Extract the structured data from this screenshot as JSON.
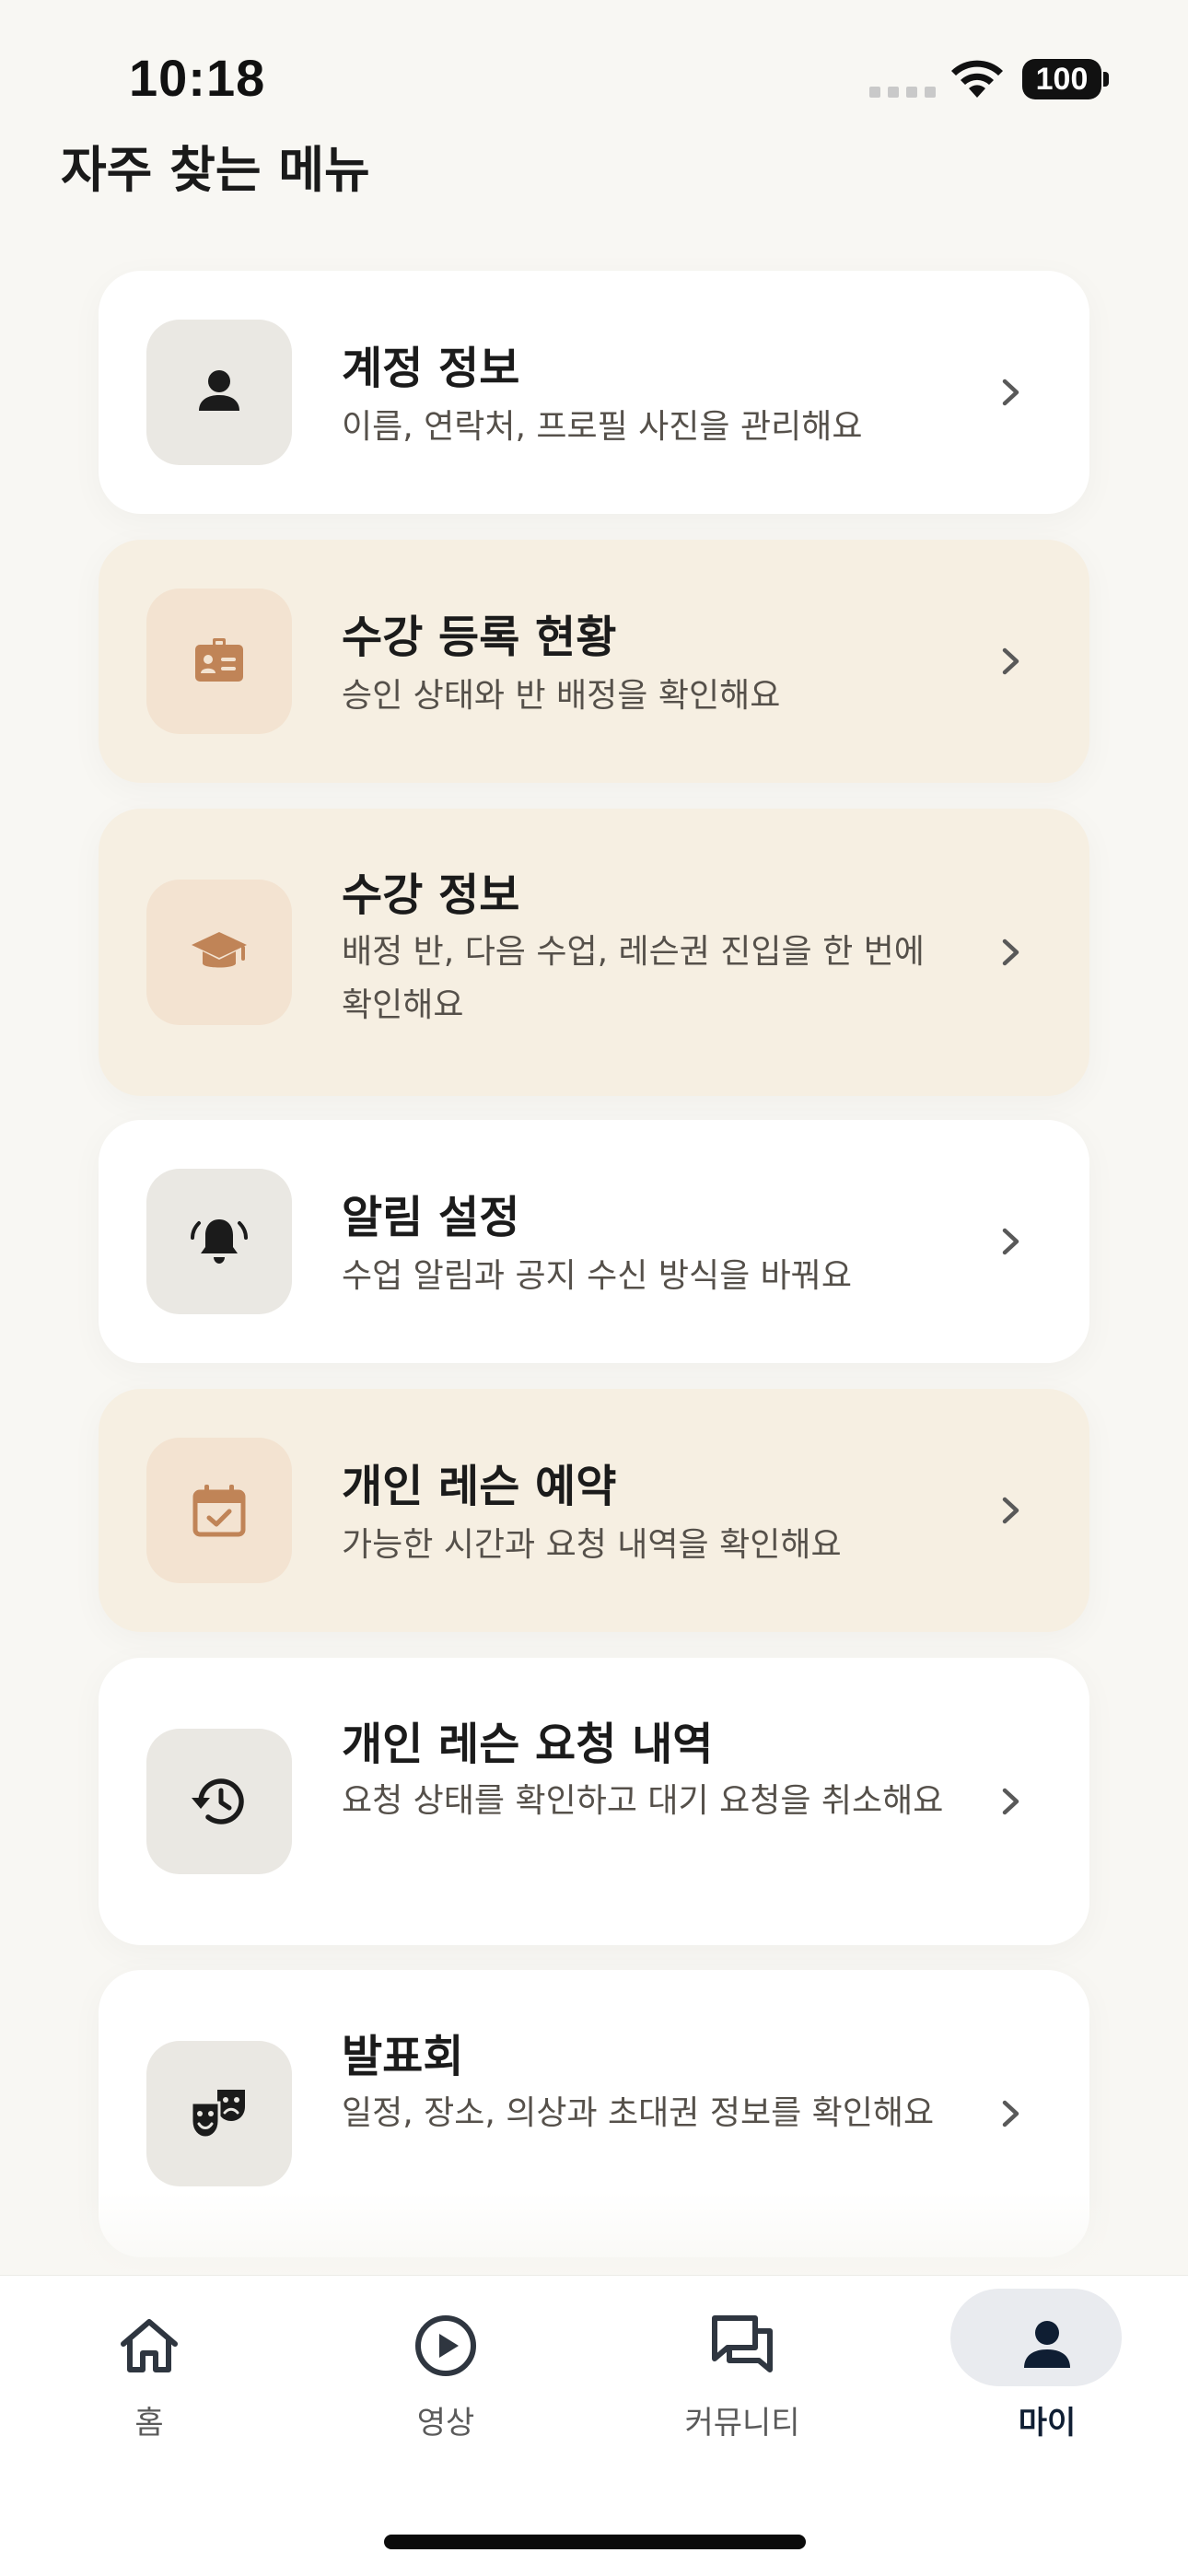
{
  "status_bar": {
    "time": "10:18",
    "battery": "100"
  },
  "section": {
    "title": "자주 찾는 메뉴"
  },
  "menu": [
    {
      "title": "계정 정보",
      "desc": "이름, 연락처, 프로필 사진을 관리해요",
      "icon": "person-icon"
    },
    {
      "title": "수강 등록 현황",
      "desc": "승인 상태와 반 배정을 확인해요",
      "icon": "id-badge-icon"
    },
    {
      "title": "수강 정보",
      "desc": "배정 반, 다음 수업, 레슨권 진입을 한 번에 확인해요",
      "icon": "graduation-cap-icon"
    },
    {
      "title": "알림 설정",
      "desc": "수업 알림과 공지 수신 방식을 바꿔요",
      "icon": "bell-ringing-icon"
    },
    {
      "title": "개인 레슨 예약",
      "desc": "가능한 시간과 요청 내역을 확인해요",
      "icon": "calendar-check-icon"
    },
    {
      "title": "개인 레슨 요청 내역",
      "desc": "요청 상태를 확인하고 대기 요청을 취소해요",
      "icon": "history-icon"
    },
    {
      "title": "발표회",
      "desc": "일정, 장소, 의상과 초대권 정보를 확인해요",
      "icon": "theater-masks-icon"
    }
  ],
  "tabs": [
    {
      "label": "홈",
      "icon": "home-icon"
    },
    {
      "label": "영상",
      "icon": "play-circle-icon"
    },
    {
      "label": "커뮤니티",
      "icon": "chat-bubbles-icon"
    },
    {
      "label": "마이",
      "icon": "person-icon",
      "active": true
    }
  ],
  "colors": {
    "background": "#f8f7f3",
    "card_white": "#ffffff",
    "card_warm": "#f6efe2",
    "icon_tile_neutral": "#eae8e3",
    "icon_tile_warm": "#f3e3d1",
    "icon_warm": "#c08457",
    "tab_active_pill": "#e9ebef",
    "tab_active_text": "#0f1e33"
  }
}
